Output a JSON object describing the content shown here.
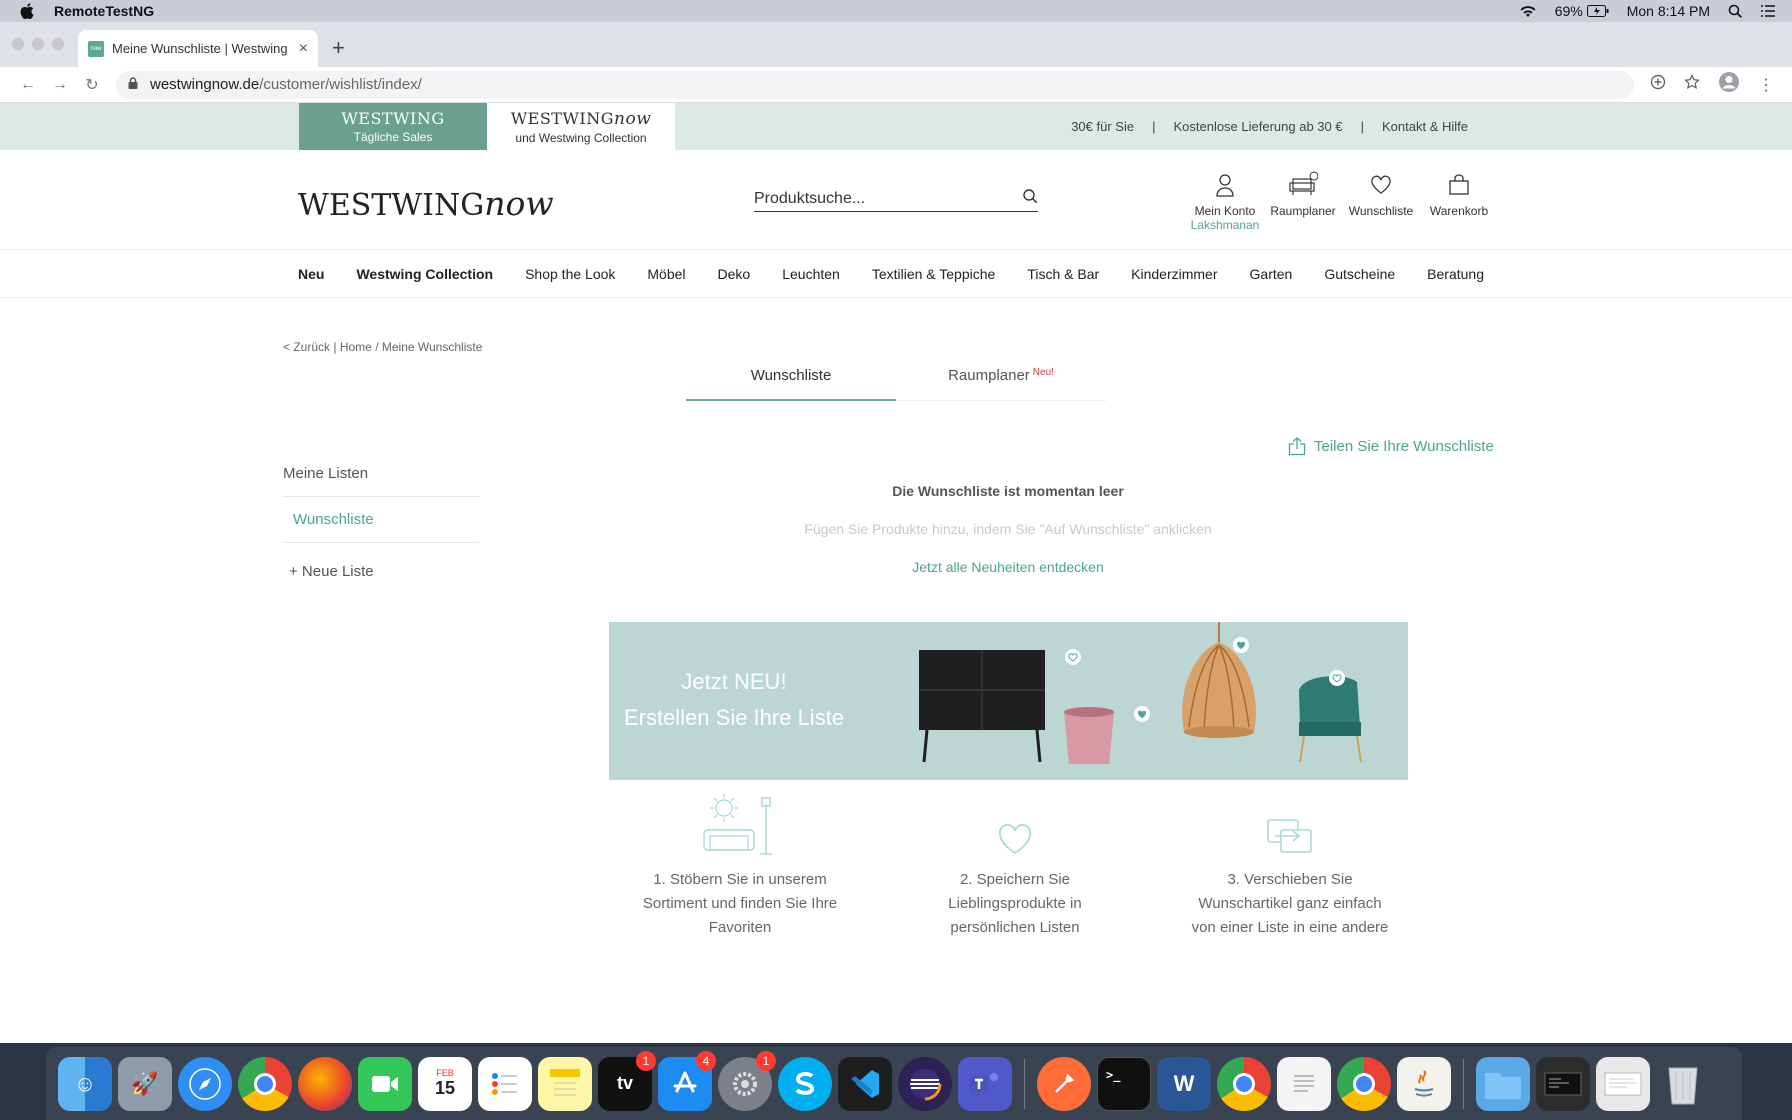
{
  "menubar": {
    "app_name": "RemoteTestNG",
    "battery": "69%",
    "clock": "Mon 8:14 PM"
  },
  "browser": {
    "tab_title": "Meine Wunschliste | Westwing",
    "favicon_text": "now",
    "url_host": "westwingnow.de",
    "url_path": "/customer/wishlist/index/"
  },
  "topstrip": {
    "sales_logo": "WESTWING",
    "sales_sub": "Tägliche Sales",
    "now_logo_main": "WESTWING",
    "now_logo_em": "now",
    "now_sub": "und Westwing Collection",
    "service_links": [
      "30€ für Sie",
      "Kostenlose Lieferung ab 30 €",
      "Kontakt & Hilfe"
    ],
    "separator": "|"
  },
  "header": {
    "brand_main": "WESTWING",
    "brand_em": "now",
    "search_placeholder": "Produktsuche...",
    "account_label": "Mein Konto",
    "account_user": "Lakshmanan",
    "planner_label": "Raumplaner",
    "wishlist_label": "Wunschliste",
    "cart_label": "Warenkorb"
  },
  "nav": [
    "Neu",
    "Westwing Collection",
    "Shop the Look",
    "Möbel",
    "Deko",
    "Leuchten",
    "Textilien & Teppiche",
    "Tisch & Bar",
    "Kinderzimmer",
    "Garten",
    "Gutscheine",
    "Beratung"
  ],
  "breadcrumb": {
    "back": "< Zurück",
    "sep": "|",
    "home": "Home",
    "slash": "/",
    "current": "Meine Wunschliste"
  },
  "wishlist_tabs": {
    "tab1": "Wunschliste",
    "tab2": "Raumplaner",
    "tab2_badge": "Neu!"
  },
  "share_label": "Teilen Sie Ihre Wunschliste",
  "sidebar": {
    "heading": "Meine Listen",
    "item": "Wunschliste",
    "add": "+ Neue Liste"
  },
  "empty_state": {
    "title": "Die Wunschliste ist momentan leer",
    "hint": "Fügen Sie Produkte hinzu, indem Sie \"Auf Wunschliste\" anklicken",
    "cta": "Jetzt alle Neuheiten entdecken"
  },
  "banner": {
    "line1": "Jetzt NEU!",
    "line2": "Erstellen Sie Ihre Liste"
  },
  "steps": [
    {
      "line1": "1. Stöbern Sie in unserem",
      "line2": "Sortiment und finden Sie Ihre",
      "line3": "Favoriten"
    },
    {
      "line1": "2. Speichern Sie",
      "line2": "Lieblingsprodukte in",
      "line3": "persönlichen Listen"
    },
    {
      "line1": "3. Verschieben Sie",
      "line2": "Wunschartikel ganz einfach",
      "line3": "von einer Liste in eine andere"
    }
  ],
  "colors": {
    "accent": "#4aa58f",
    "sales_green": "#6b9f8f",
    "strip_bg": "#dde9e5",
    "banner_bg": "#bcd6d3",
    "badge_red": "#d1364a"
  },
  "dock": {
    "calendar_month": "FEB",
    "calendar_day": "15",
    "tv_label": "tv",
    "badges": {
      "tv": "1",
      "appstore": "4",
      "settings": "1"
    }
  }
}
